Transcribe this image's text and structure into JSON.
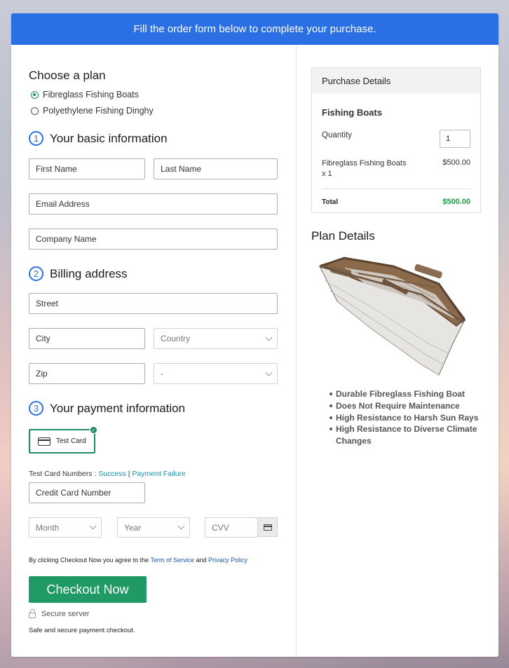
{
  "banner": {
    "text": "Fill the order form below to complete your purchase."
  },
  "plan": {
    "heading": "Choose a plan",
    "options": [
      {
        "label": "Fibreglass Fishing Boats",
        "selected": true
      },
      {
        "label": "Polyethylene Fishing Dinghy",
        "selected": false
      }
    ]
  },
  "basic": {
    "num": "1",
    "heading": "Your basic information",
    "first_name": "First Name",
    "last_name": "Last Name",
    "email": "Email Address",
    "company": "Company Name"
  },
  "billing": {
    "num": "2",
    "heading": "Billing address",
    "street": "Street",
    "city": "City",
    "country": "Country",
    "zip": "Zip",
    "state": "-"
  },
  "payment": {
    "num": "3",
    "heading": "Your payment information",
    "card_tile_label": "Test Card",
    "test_numbers_prefix": "Test Card Numbers : ",
    "success_link": "Success",
    "separator": " | ",
    "failure_link": "Payment Failure",
    "card_number": "Credit Card Number",
    "month": "Month",
    "year": "Year",
    "cvv": "CVV"
  },
  "agreement": {
    "prefix": "By clicking Checkout Now you agree to the ",
    "terms_link": "Term of Service",
    "and": " and ",
    "privacy_link": "Privacy Policy"
  },
  "checkout": {
    "button_label": "Checkout Now",
    "secure_label": "Secure server",
    "safe_text": "Safe and secure payment checkout."
  },
  "purchase": {
    "header": "Purchase Details",
    "title": "Fishing Boats",
    "quantity_label": "Quantity",
    "quantity_value": "1",
    "item_name": "Fibreglass Fishing Boats",
    "item_qty": "x 1",
    "item_price": "$500.00",
    "total_label": "Total",
    "total_value": "$500.00",
    "total_color": "#1f9a44"
  },
  "plan_details": {
    "heading": "Plan Details",
    "features": [
      "Durable Fibreglass Fishing Boat",
      "Does Not Require Maintenance",
      "High Resistance to Harsh Sun Rays",
      "High Resistance to Diverse Climate Changes"
    ]
  },
  "colors": {
    "accent": "#2a6fe4",
    "brand_green": "#1f9a64",
    "selection": "#1f8a6e"
  }
}
